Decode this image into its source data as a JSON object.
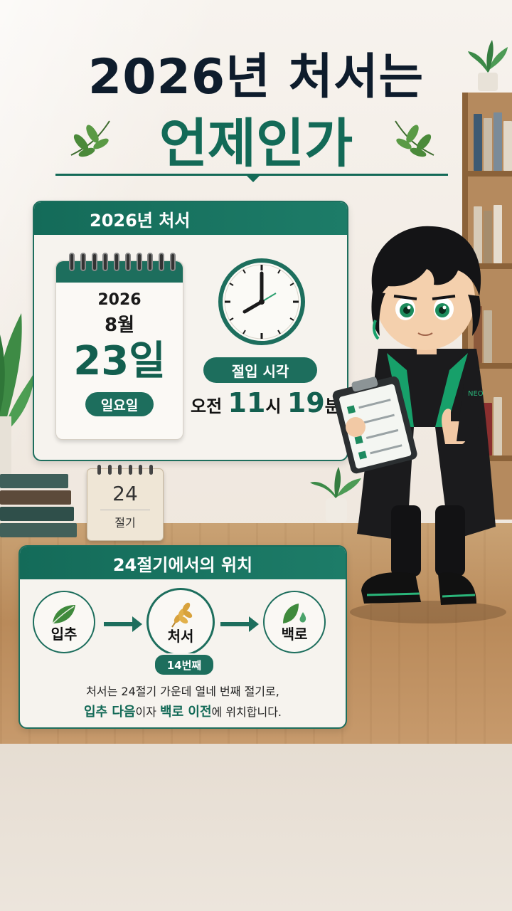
{
  "header": {
    "title_line1": "2026년 처서는",
    "title_line2": "언제인가"
  },
  "date_card": {
    "heading": "2026년 처서",
    "calendar": {
      "year": "2026",
      "month": "8월",
      "day": "23일",
      "weekday": "일요일"
    },
    "term_label": "절입 시각",
    "time": {
      "ampm": "오전",
      "hour": "11",
      "hour_unit": "시",
      "minute": "19",
      "minute_unit": "분"
    }
  },
  "desk_calendar": {
    "number": "24",
    "label": "절기"
  },
  "position_card": {
    "heading": "24절기에서의 위치",
    "prev": "입추",
    "current": "처서",
    "next": "백로",
    "order": "14번째",
    "desc_line1": "처서는 24절기 가운데 열네 번째 절기로,",
    "desc_line2": {
      "part1": "입추 다음",
      "part2": "이자 ",
      "part3": "백로 이전",
      "part4": "에 위치합니다."
    }
  },
  "character": {
    "badge_text": "NEO"
  },
  "colors": {
    "accent": "#1d6e5d",
    "title_dark": "#0e1c2c",
    "title_green": "#136a57"
  }
}
